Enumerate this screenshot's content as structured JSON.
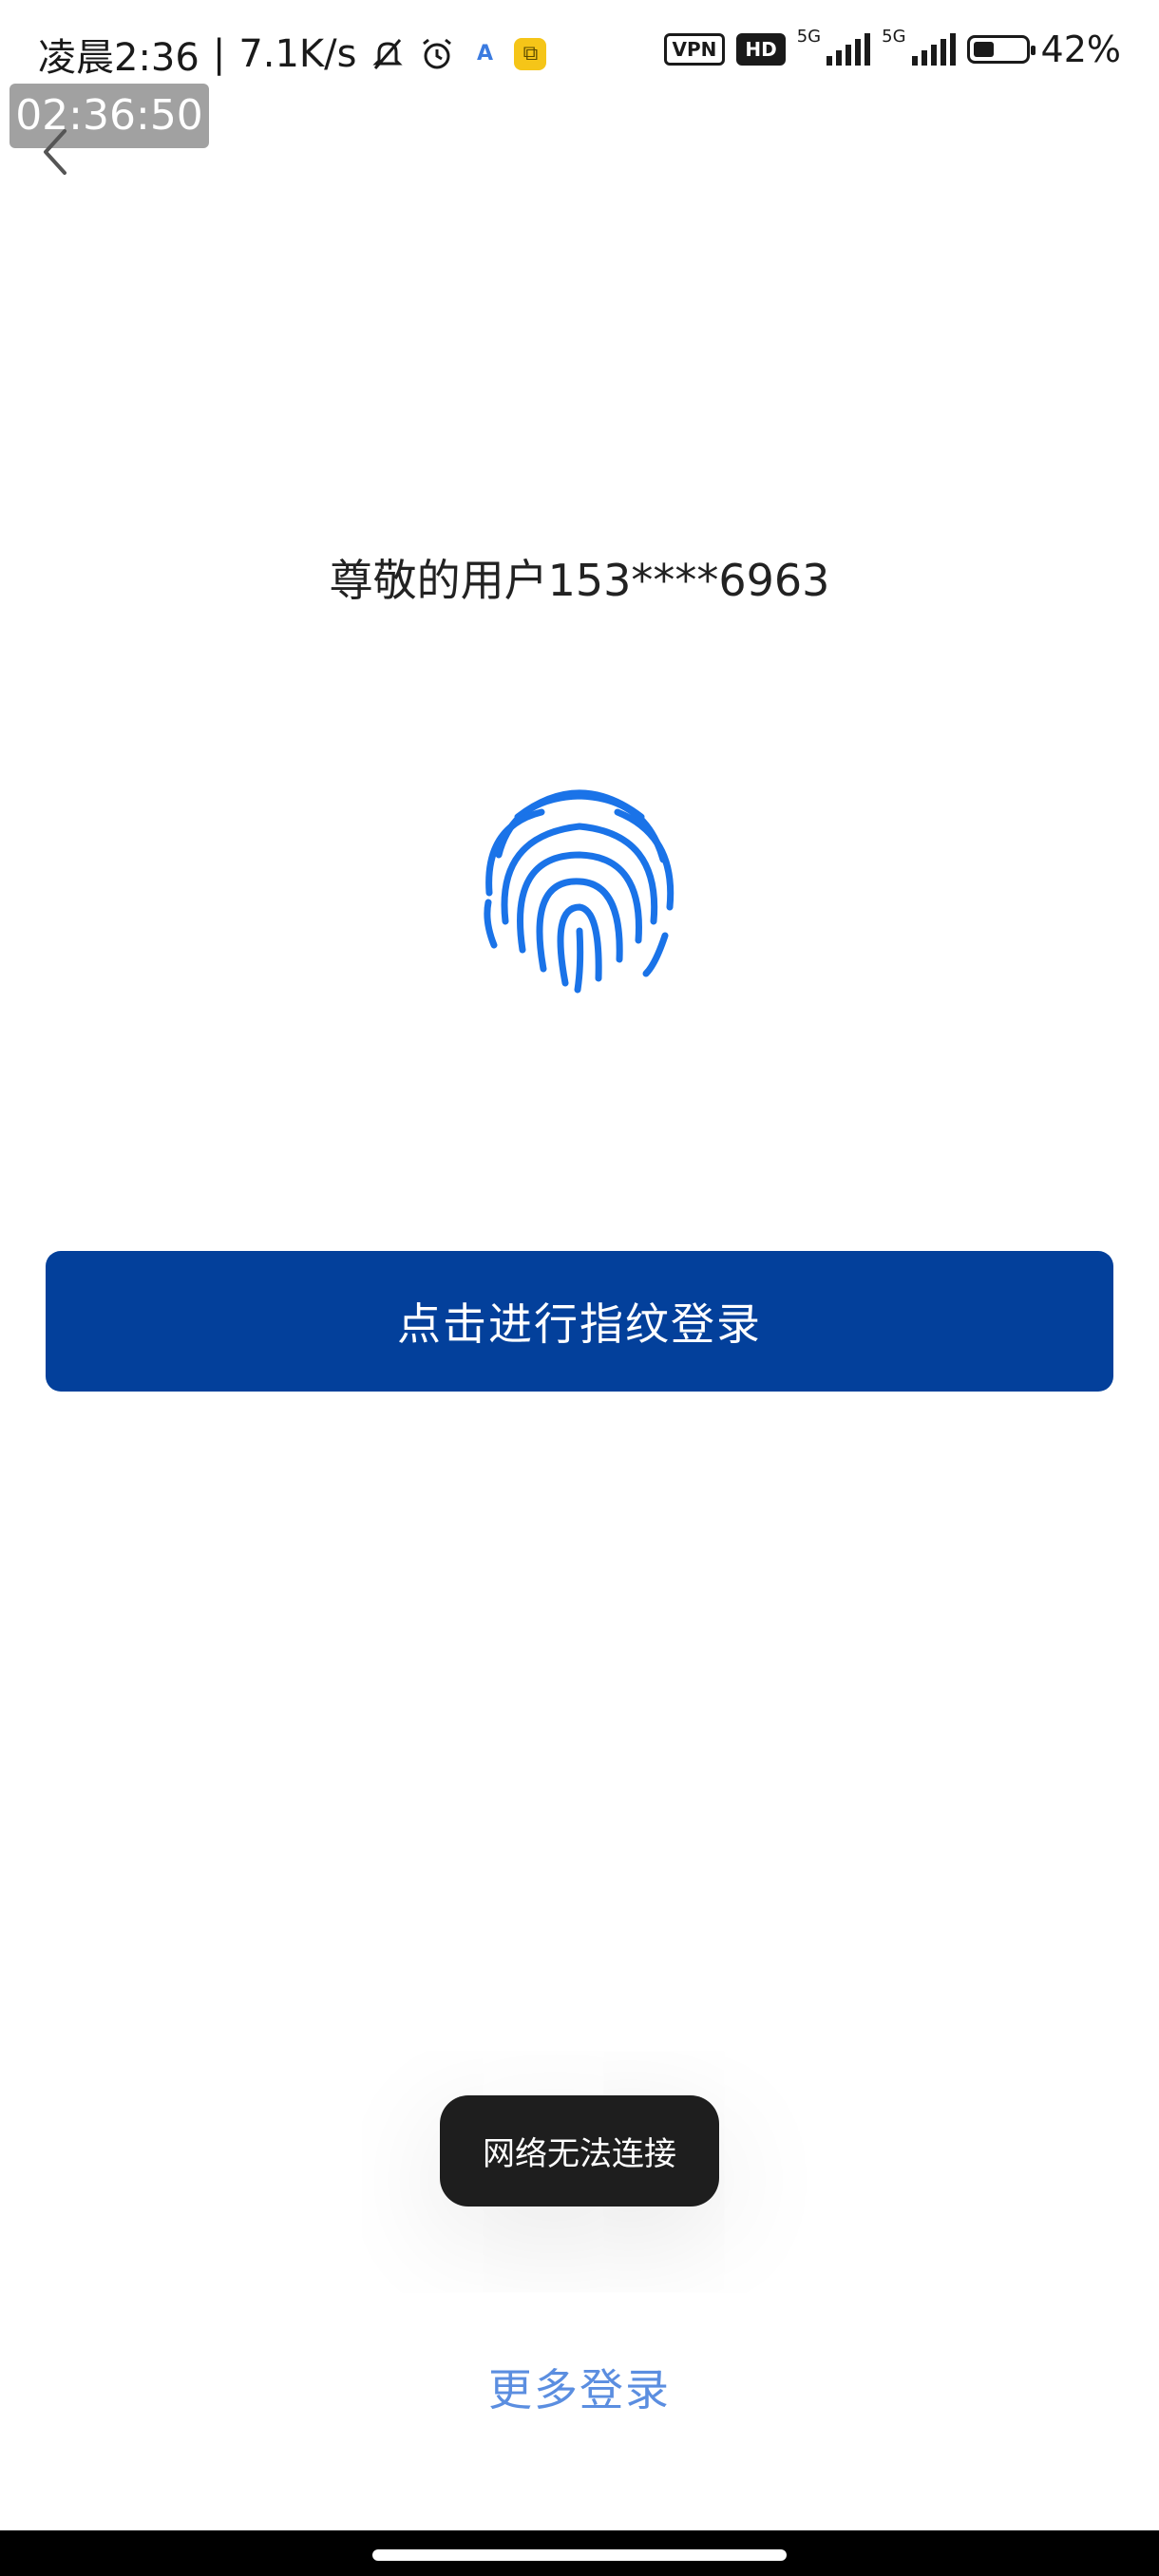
{
  "status_bar": {
    "time": "凌晨2:36",
    "net_speed": "7.1K/s",
    "vpn_label": "VPN",
    "hd_label": "HD",
    "signal1_label": "5G",
    "signal2_label": "5G",
    "battery_percent": "42%",
    "battery_level": 0.42,
    "icons": [
      "mute-bell-icon",
      "alarm-icon",
      "app-a-icon",
      "copy-app-icon"
    ]
  },
  "timer_overlay": "02:36:50",
  "greeting": "尊敬的用户153****6963",
  "fingerprint_color": "#1a73e8",
  "login_button": {
    "label": "点击进行指纹登录",
    "color": "#03409b"
  },
  "toast": "网络无法连接",
  "more_login": "更多登录"
}
